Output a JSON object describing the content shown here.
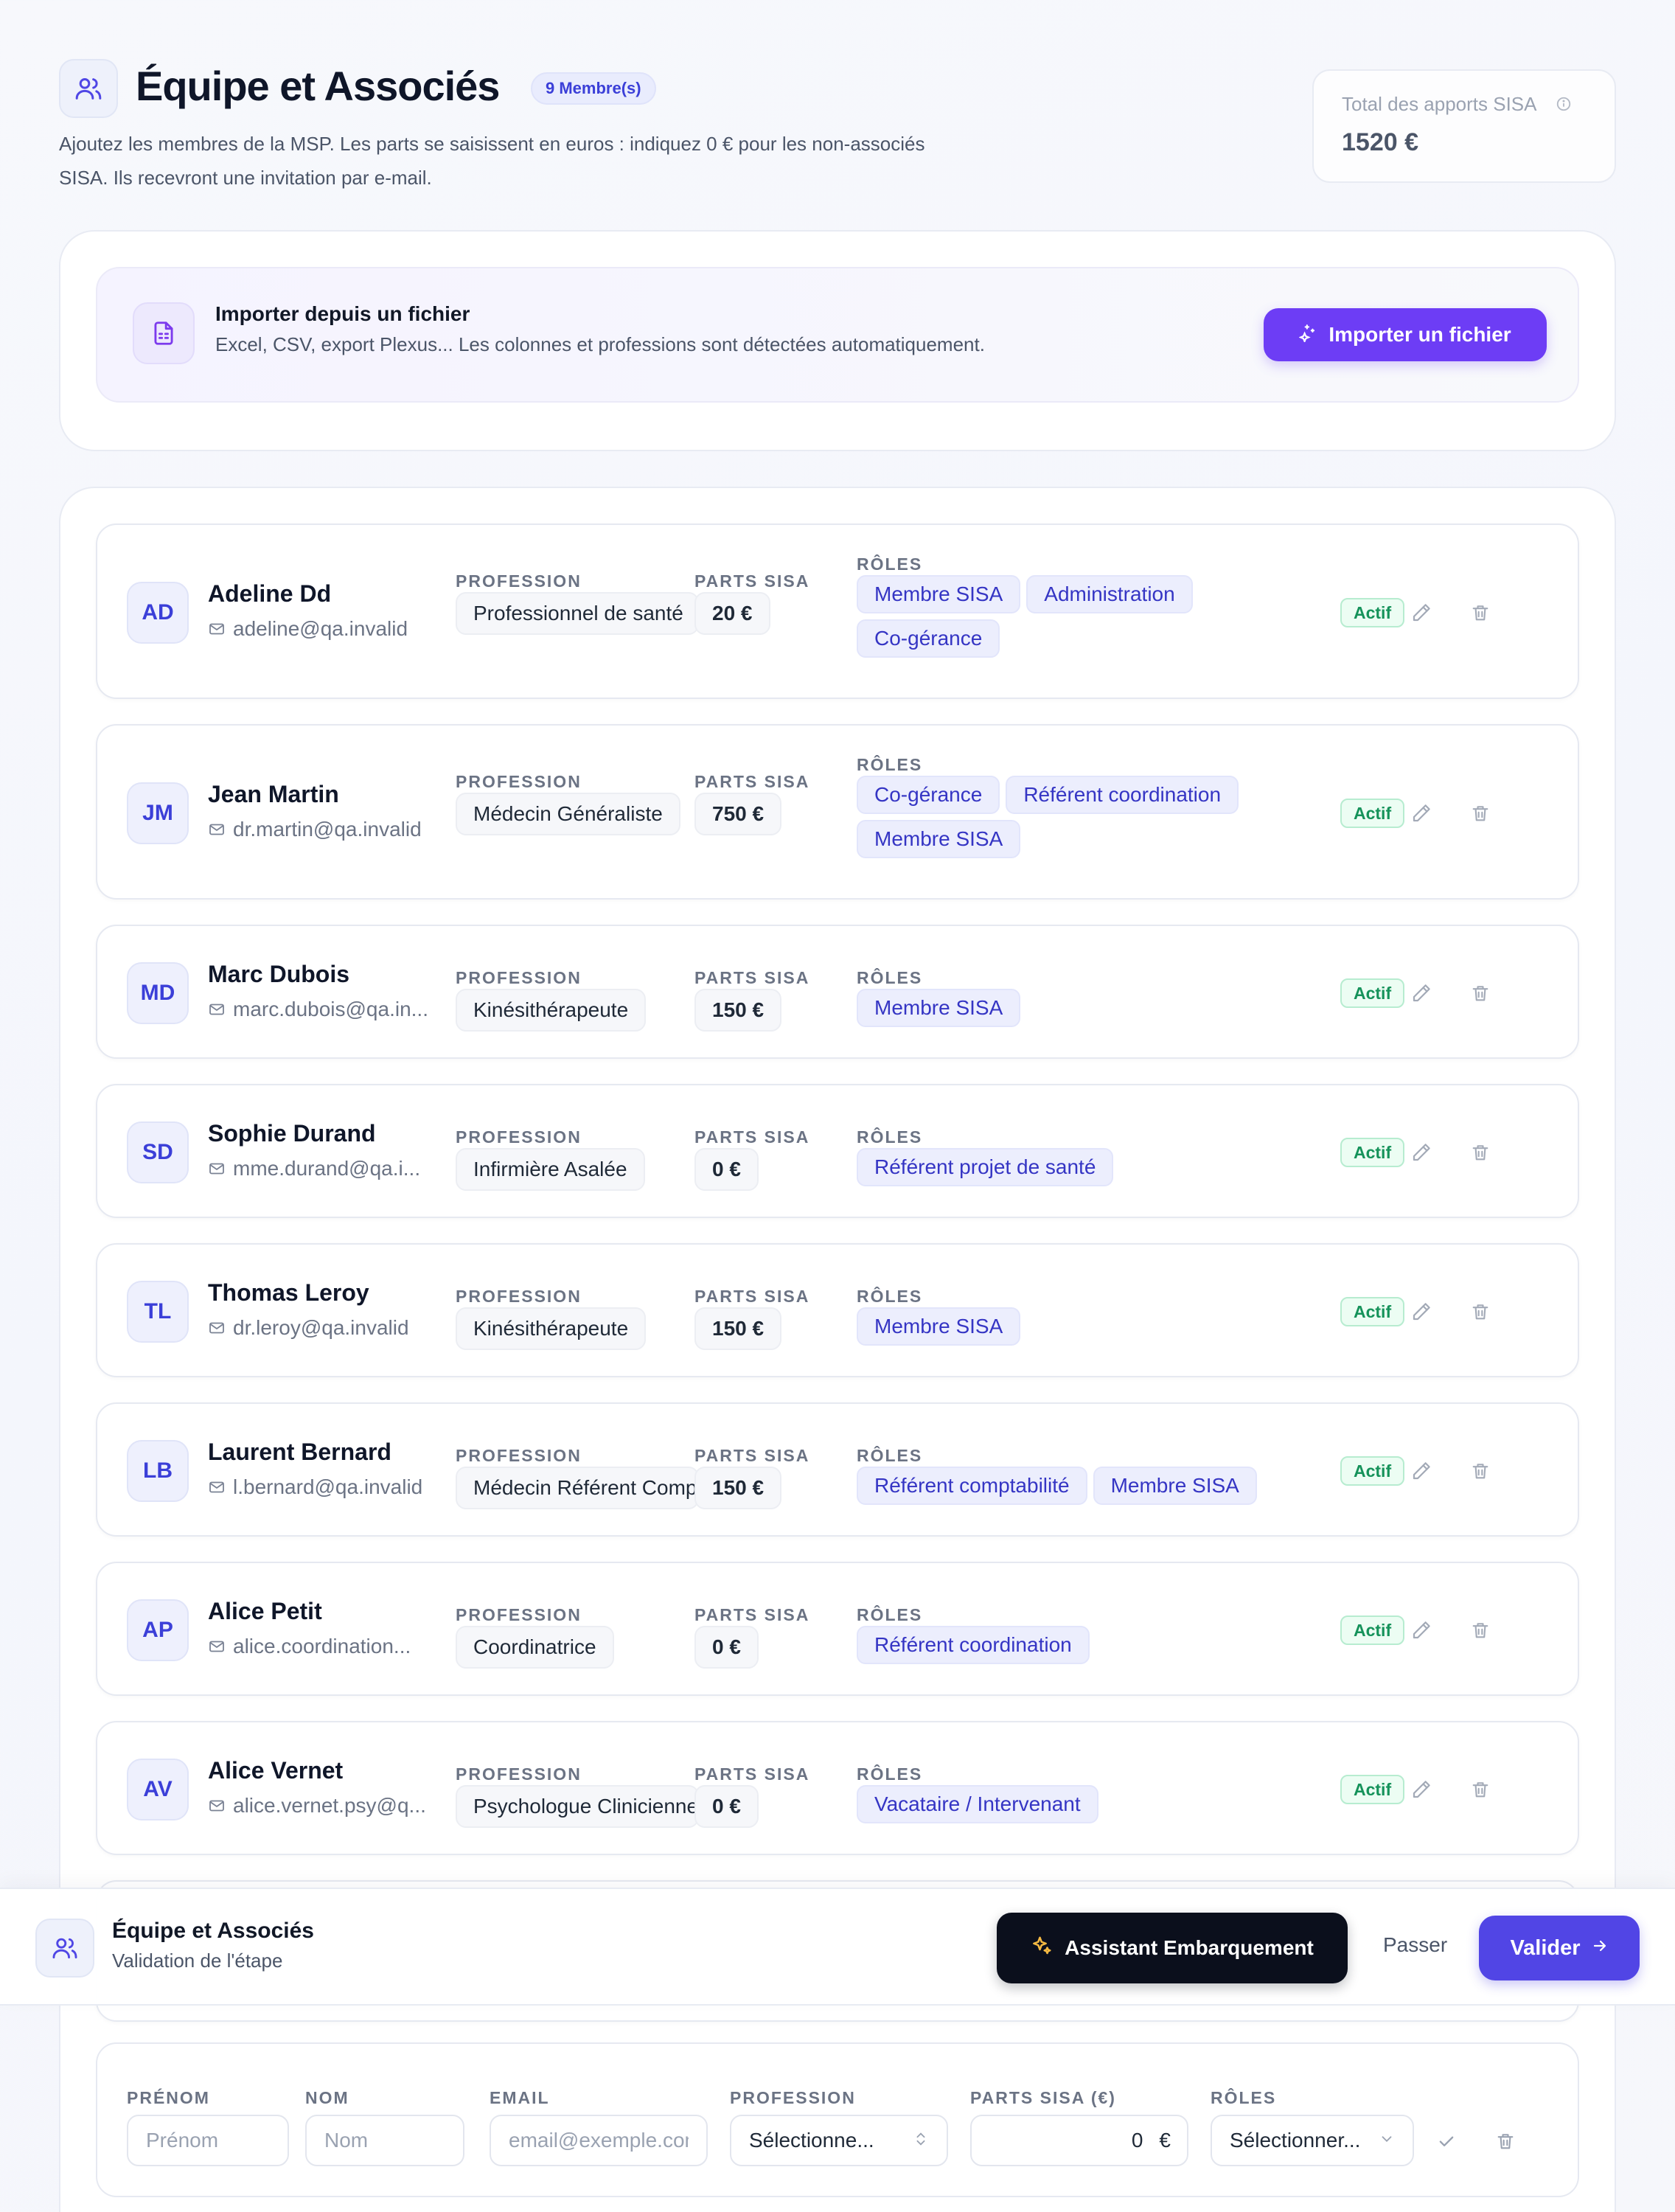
{
  "header": {
    "title": "Équipe et Associés",
    "member_badge": "9 Membre(s)",
    "description": "Ajoutez les membres de la MSP. Les parts se saisissent en euros : indiquez 0 € pour les non-associés SISA. Ils recevront une invitation par e-mail.",
    "total_label": "Total des apports SISA",
    "total_value": "1520 €"
  },
  "import": {
    "title": "Importer depuis un fichier",
    "subtitle": "Excel, CSV, export Plexus... Les colonnes et professions sont détectées automatiquement.",
    "button_label": "Importer un fichier"
  },
  "labels": {
    "profession": "PROFESSION",
    "parts": "PARTS SISA",
    "roles": "RÔLES"
  },
  "members": [
    {
      "initials": "AD",
      "name": "Adeline Dd",
      "email": "adeline@qa.invalid",
      "profession": "Professionnel de santé",
      "parts": "20 €",
      "roles": [
        "Membre SISA",
        "Administration",
        "Co-gérance"
      ],
      "status": "Actif"
    },
    {
      "initials": "JM",
      "name": "Jean Martin",
      "email": "dr.martin@qa.invalid",
      "profession": "Médecin Généraliste",
      "parts": "750 €",
      "roles": [
        "Co-gérance",
        "Référent coordination",
        "Membre SISA"
      ],
      "status": "Actif"
    },
    {
      "initials": "MD",
      "name": "Marc Dubois",
      "email": "marc.dubois@qa.in...",
      "profession": "Kinésithérapeute",
      "parts": "150 €",
      "roles": [
        "Membre SISA"
      ],
      "status": "Actif"
    },
    {
      "initials": "SD",
      "name": "Sophie Durand",
      "email": "mme.durand@qa.i...",
      "profession": "Infirmière Asalée",
      "parts": "0 €",
      "roles": [
        "Référent projet de santé"
      ],
      "status": "Actif"
    },
    {
      "initials": "TL",
      "name": "Thomas Leroy",
      "email": "dr.leroy@qa.invalid",
      "profession": "Kinésithérapeute",
      "parts": "150 €",
      "roles": [
        "Membre SISA"
      ],
      "status": "Actif"
    },
    {
      "initials": "LB",
      "name": "Laurent Bernard",
      "email": "l.bernard@qa.invalid",
      "profession": "Médecin Référent Comp",
      "parts": "150 €",
      "roles": [
        "Référent comptabilité",
        "Membre SISA"
      ],
      "status": "Actif"
    },
    {
      "initials": "AP",
      "name": "Alice Petit",
      "email": "alice.coordination...",
      "profession": "Coordinatrice",
      "parts": "0 €",
      "roles": [
        "Référent coordination"
      ],
      "status": "Actif"
    },
    {
      "initials": "AV",
      "name": "Alice Vernet",
      "email": "alice.vernet.psy@q...",
      "profession": "Psychologue Clinicienne",
      "parts": "0 €",
      "roles": [
        "Vacataire / Intervenant"
      ],
      "status": "Actif"
    }
  ],
  "form": {
    "firstname_label": "PRÉNOM",
    "firstname_placeholder": "Prénom",
    "lastname_label": "NOM",
    "lastname_placeholder": "Nom",
    "email_label": "EMAIL",
    "email_placeholder": "email@exemple.com",
    "profession_label": "PROFESSION",
    "profession_value": "Sélectionne...",
    "parts_label": "PARTS SISA (€)",
    "parts_value": "0",
    "parts_currency": "€",
    "roles_label": "RÔLES",
    "roles_value": "Sélectionner..."
  },
  "action_bar": {
    "title": "Équipe et Associés",
    "subtitle": "Validation de l'étape",
    "assistant_label": "Assistant Embarquement",
    "skip_label": "Passer",
    "validate_label": "Valider"
  },
  "colors": {
    "accent": "#5145e5",
    "import_accent": "#6d3df5",
    "role_tag_text": "#3535c4",
    "status_active": "#15925a"
  }
}
